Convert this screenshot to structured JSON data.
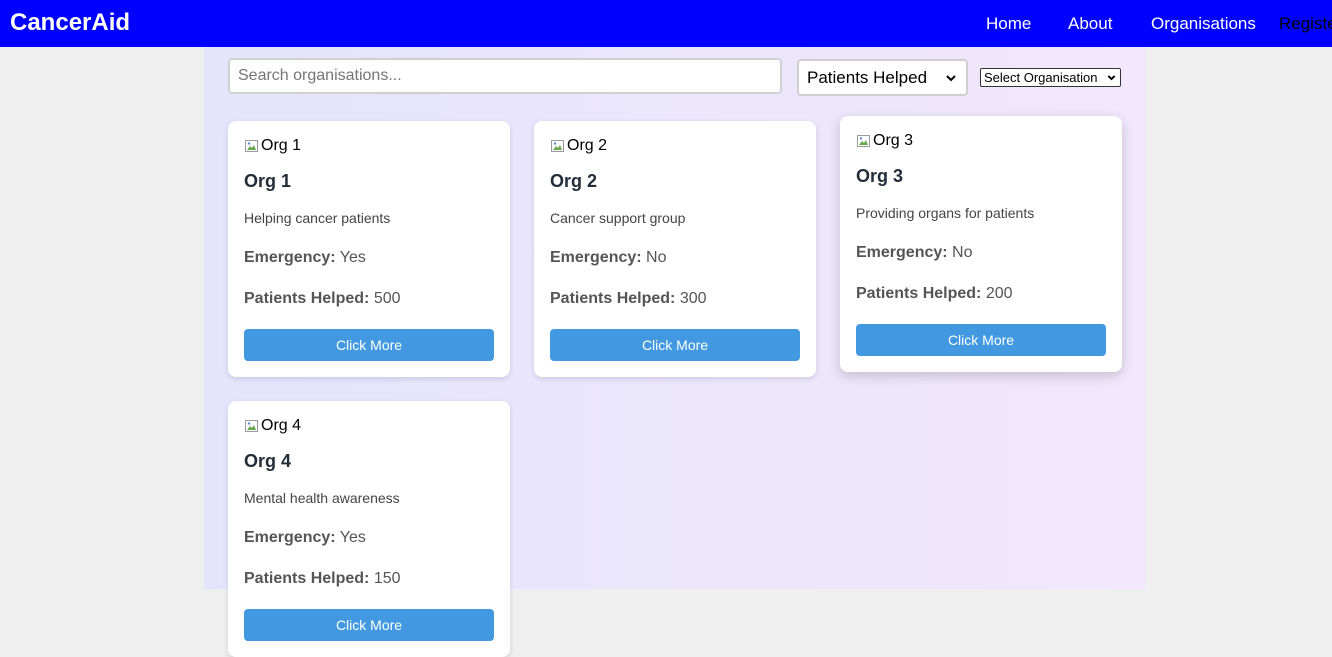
{
  "navbar": {
    "brand": "CancerAid",
    "links": [
      "Home",
      "About",
      "Organisations",
      "Register"
    ]
  },
  "search": {
    "placeholder": "Search organisations..."
  },
  "filters": {
    "sort_selected": "Patients Helped",
    "org_selected": "Select Organisation"
  },
  "labels": {
    "emergency": "Emergency:",
    "patients_helped": "Patients Helped:"
  },
  "colors": {
    "navbar": "#0000ff",
    "button": "#4299e1"
  },
  "cards": [
    {
      "img_alt": "Org 1",
      "name": "Org 1",
      "description": "Helping cancer patients",
      "emergency": "Yes",
      "patients_helped": "500",
      "button": "Click More"
    },
    {
      "img_alt": "Org 2",
      "name": "Org 2",
      "description": "Cancer support group",
      "emergency": "No",
      "patients_helped": "300",
      "button": "Click More"
    },
    {
      "img_alt": "Org 3",
      "name": "Org 3",
      "description": "Providing organs for patients",
      "emergency": "No",
      "patients_helped": "200",
      "button": "Click More"
    },
    {
      "img_alt": "Org 4",
      "name": "Org 4",
      "description": "Mental health awareness",
      "emergency": "Yes",
      "patients_helped": "150",
      "button": "Click More"
    }
  ]
}
